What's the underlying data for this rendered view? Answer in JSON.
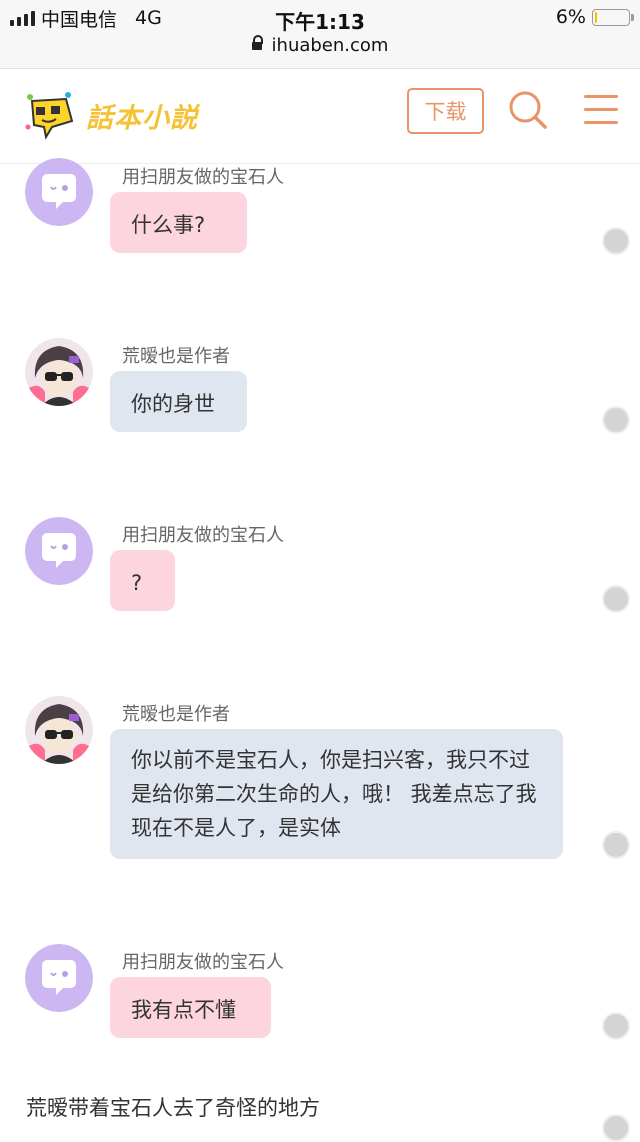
{
  "status_bar": {
    "carrier": "中国电信",
    "network": "4G",
    "time": "下午1:13",
    "battery": "6%",
    "battery_level": 0.06,
    "url": "ihuaben.com"
  },
  "header": {
    "logo_text": "話本小説",
    "download_label": "下载",
    "icons": [
      "search-icon",
      "menu-icon"
    ],
    "accent_color": "#e99467",
    "logo_color": "#f5c233"
  },
  "messages": [
    {
      "name": "用扫朋友做的宝石人",
      "text": "什么事?",
      "style": "pink"
    },
    {
      "name": "荒暧也是作者",
      "text": "你的身世",
      "style": "gray"
    },
    {
      "name": "用扫朋友做的宝石人",
      "text": "?",
      "style": "pink"
    },
    {
      "name": "荒暧也是作者",
      "text": "你以前不是宝石人，你是扫兴客，我只不过是给你第二次生命的人，哦！ 我差点忘了我现在不是人了，是实体",
      "style": "gray"
    },
    {
      "name": "用扫朋友做的宝石人",
      "text": "我有点不懂",
      "style": "pink"
    }
  ],
  "narration": "荒暧带着宝石人去了奇怪的地方"
}
